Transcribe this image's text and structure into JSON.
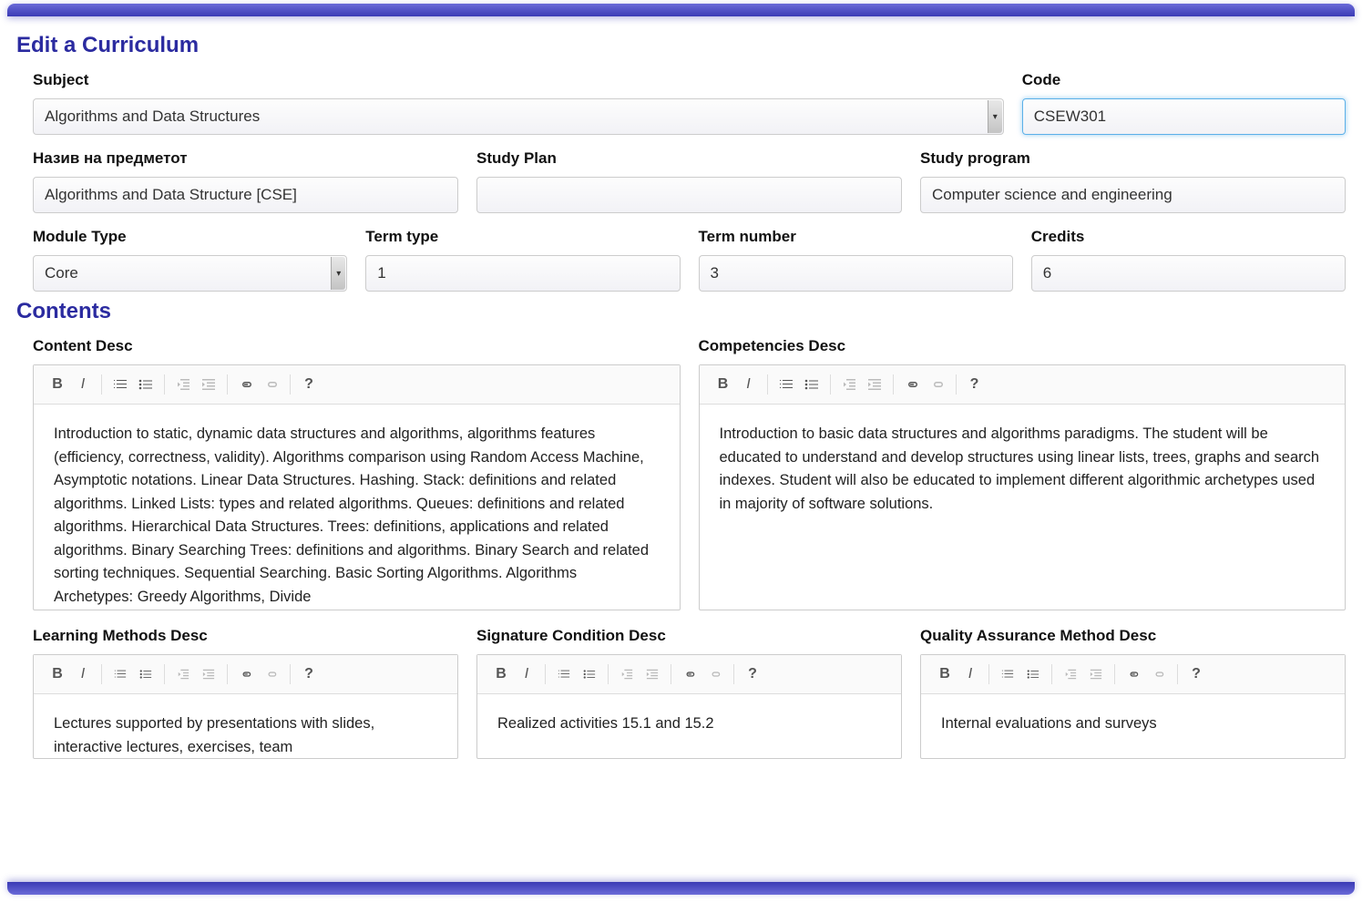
{
  "page": {
    "title": "Edit a Curriculum",
    "contents_title": "Contents"
  },
  "fields": {
    "subject_label": "Subject",
    "subject_value": "Algorithms and Data Structures",
    "code_label": "Code",
    "code_value": "CSEW301",
    "naziv_label": "Назив на предметот",
    "naziv_value": "Algorithms and Data Structure [CSE]",
    "study_plan_label": "Study Plan",
    "study_plan_value": "",
    "study_program_label": "Study program",
    "study_program_value": "Computer science and engineering",
    "module_type_label": "Module Type",
    "module_type_value": "Core",
    "term_type_label": "Term type",
    "term_type_value": "1",
    "term_number_label": "Term number",
    "term_number_value": "3",
    "credits_label": "Credits",
    "credits_value": "6"
  },
  "editors": {
    "content_label": "Content Desc",
    "content_body": "Introduction to static, dynamic data structures and algorithms, algorithms features  (efficiency, correctness, validity). Algorithms comparison using Random  Access Machine,  Asymptotic notations. Linear Data Structures. Hashing. Stack: definitions and related algorithms.  Linked Lists: types and related algorithms. Queues: definitions and related algorithms. Hierarchical Data Structures. Trees: definitions, applications and related algorithms. Binary  Searching Trees: definitions and algorithms. Binary Search and related sorting techniques.  Sequential Searching. Basic Sorting Algorithms. Algorithms Archetypes: Greedy Algorithms,   Divide",
    "competencies_label": "Competencies Desc",
    "competencies_body": "Introduction to basic data structures and algorithms paradigms. The student will be educated to understand and develop structures using linear lists, trees, graphs and search indexes. Student will also be educated to implement different algorithmic archetypes used in majority of software solutions.",
    "learning_label": "Learning Methods Desc",
    "learning_body": "Lectures supported by presentations with slides, interactive lectures, exercises, team",
    "signature_label": "Signature Condition Desc",
    "signature_body": "Realized activities 15.1 and 15.2",
    "qa_label": "Quality Assurance Method Desc",
    "qa_body": "Internal evaluations and surveys"
  },
  "toolbar_icons": {
    "bold": "bold-icon",
    "italic": "italic-icon",
    "olist": "ordered-list-icon",
    "ulist": "unordered-list-icon",
    "outdent": "outdent-icon",
    "indent": "indent-icon",
    "link": "link-icon",
    "unlink": "unlink-icon",
    "help": "help-icon"
  }
}
